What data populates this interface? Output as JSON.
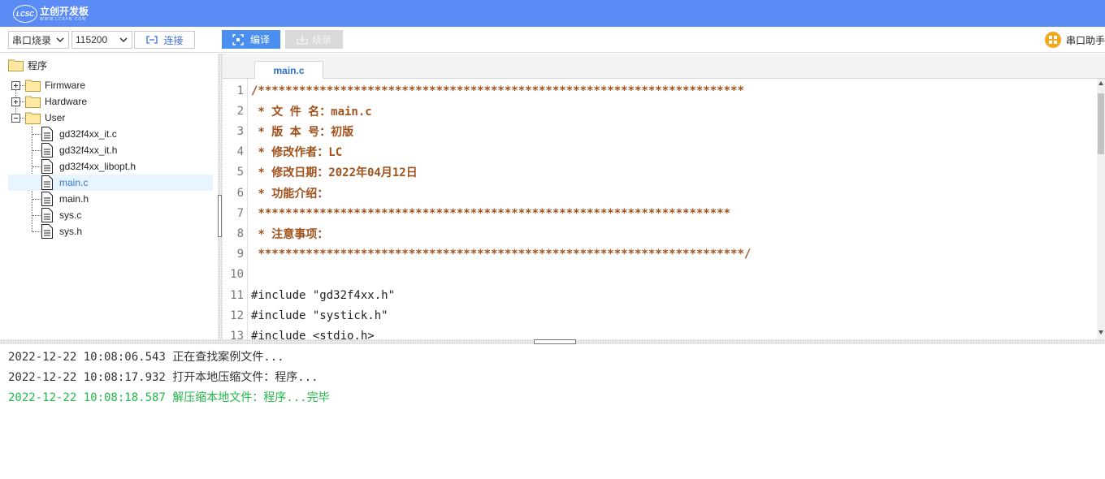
{
  "app": {
    "logo_badge": "LCSC",
    "logo_name": "立创开发板",
    "logo_site": "WWW.LCKFB.COM"
  },
  "toolbar": {
    "mode_value": "串口烧录",
    "baud_value": "115200",
    "connect_label": "连接",
    "compile_label": "编译",
    "burn_label": "烧录",
    "serial_helper_label": "串口助手"
  },
  "tree": {
    "root": "程序",
    "folders": [
      "Firmware",
      "Hardware",
      "User"
    ],
    "files": [
      "gd32f4xx_it.c",
      "gd32f4xx_it.h",
      "gd32f4xx_libopt.h",
      "main.c",
      "main.h",
      "sys.c",
      "sys.h"
    ],
    "selected": "main.c"
  },
  "editor": {
    "active_tab": "main.c",
    "lines": [
      {
        "n": "1",
        "text": "/***********************************************************************",
        "kind": "cmt"
      },
      {
        "n": "2",
        "text": " * 文 件 名：main.c",
        "kind": "cmt"
      },
      {
        "n": "3",
        "text": " * 版 本 号：初版",
        "kind": "cmt"
      },
      {
        "n": "4",
        "text": " * 修改作者：LC",
        "kind": "cmt"
      },
      {
        "n": "5",
        "text": " * 修改日期：2022年04月12日",
        "kind": "cmt"
      },
      {
        "n": "6",
        "text": " * 功能介绍：",
        "kind": "cmt"
      },
      {
        "n": "7",
        "text": " *********************************************************************",
        "kind": "cmt"
      },
      {
        "n": "8",
        "text": " * 注意事项：",
        "kind": "cmt"
      },
      {
        "n": "9",
        "text": " ***********************************************************************/",
        "kind": "cmt"
      },
      {
        "n": "10",
        "text": "",
        "kind": "src"
      },
      {
        "n": "11",
        "text": "#include \"gd32f4xx.h\"",
        "kind": "src"
      },
      {
        "n": "12",
        "text": "#include \"systick.h\"",
        "kind": "src"
      },
      {
        "n": "13",
        "text": "#include <stdio.h>",
        "kind": "src"
      }
    ]
  },
  "log": [
    {
      "text": "2022-12-22 10:08:06.543 正在查找案例文件...",
      "status": "info"
    },
    {
      "text": "2022-12-22 10:08:17.932 打开本地压缩文件：程序...",
      "status": "info"
    },
    {
      "text": "2022-12-22 10:08:18.587 解压缩本地文件：程序...完毕",
      "status": "success"
    }
  ],
  "colors": {
    "titlebar": "#5b8cf5",
    "accent": "#4a8ff0",
    "comment": "#a0521d",
    "success": "#22b84a"
  }
}
